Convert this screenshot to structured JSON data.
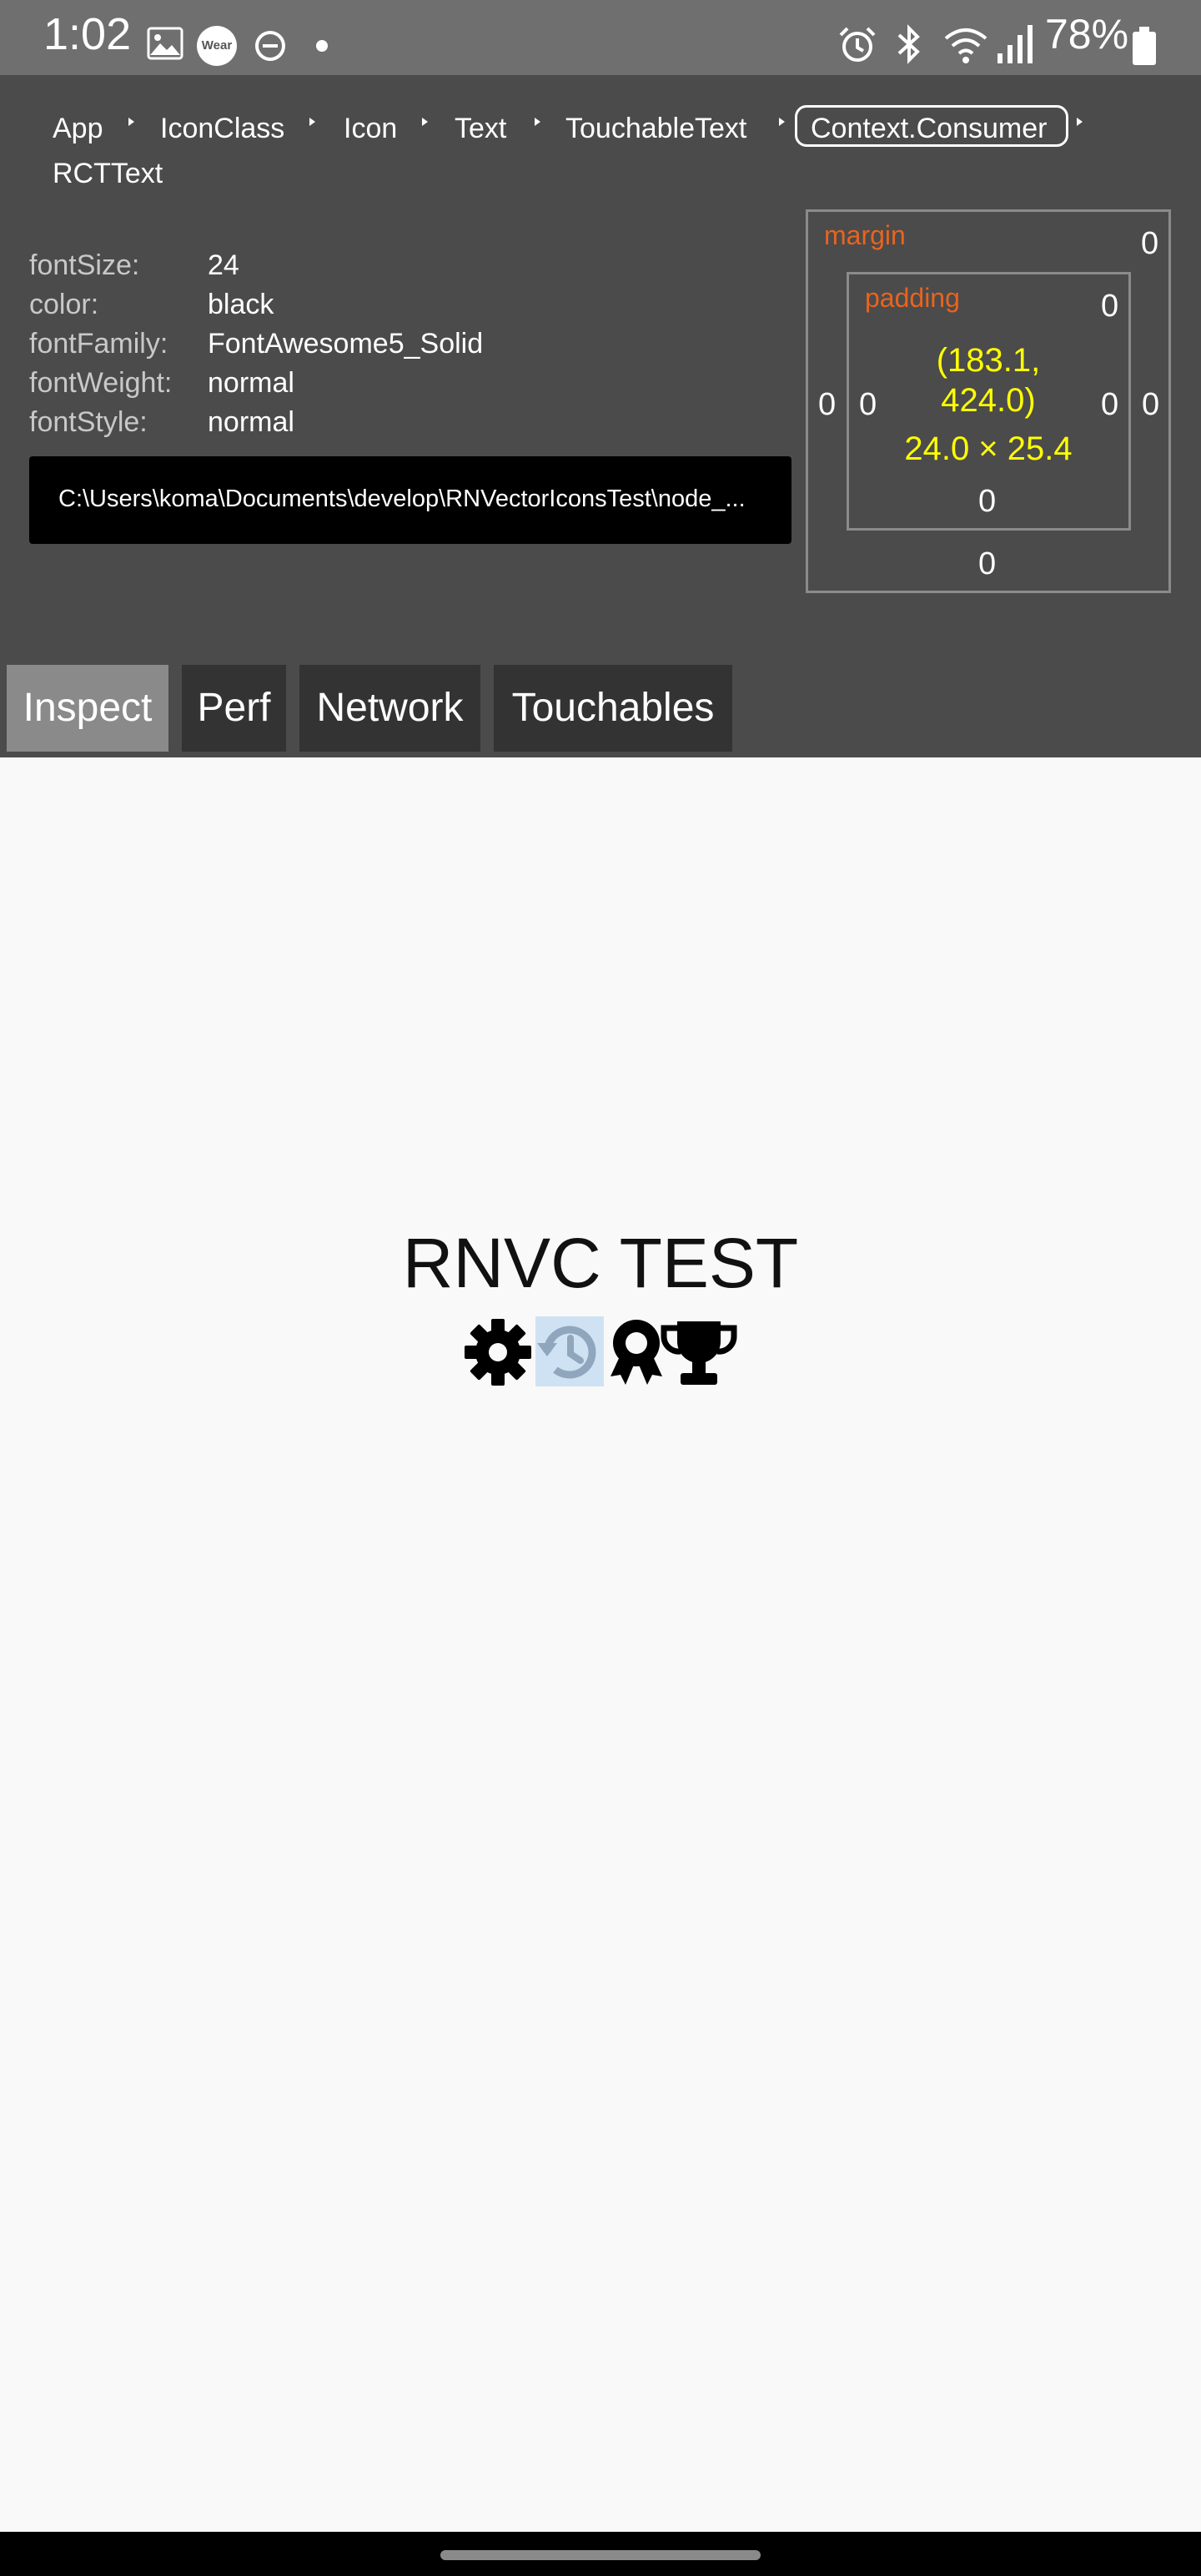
{
  "status_bar": {
    "time": "1:02",
    "battery": "78%",
    "icons": [
      "gallery-icon",
      "wear-icon",
      "do-not-disturb-icon",
      "dot-icon",
      "alarm-icon",
      "bluetooth-icon",
      "wifi-icon",
      "signal-icon",
      "battery-icon"
    ],
    "wear_label": "Wear"
  },
  "breadcrumb": {
    "items": [
      "App",
      "IconClass",
      "Icon",
      "Text",
      "TouchableText",
      "Context.Consumer",
      "RCTText"
    ],
    "selected": "Context.Consumer"
  },
  "style_props": [
    {
      "key": "fontSize:",
      "value": "24"
    },
    {
      "key": "color:",
      "value": "black"
    },
    {
      "key": "fontFamily:",
      "value": "FontAwesome5_Solid"
    },
    {
      "key": "fontWeight:",
      "value": "normal"
    },
    {
      "key": "fontStyle:",
      "value": "normal"
    }
  ],
  "source_path": "C:\\Users\\koma\\Documents\\develop\\RNVectorIconsTest\\node_...",
  "box_model": {
    "margin_label": "margin",
    "padding_label": "padding",
    "margin": {
      "top": "0",
      "right": "0",
      "bottom": "0",
      "left": "0"
    },
    "padding": {
      "top": "0",
      "right": "0",
      "bottom": "0",
      "left": "0"
    },
    "position_line1": "(183.1,",
    "position_line2": "424.0)",
    "size": "24.0 × 25.4"
  },
  "tabs": [
    {
      "label": "Inspect",
      "active": true
    },
    {
      "label": "Perf",
      "active": false
    },
    {
      "label": "Network",
      "active": false
    },
    {
      "label": "Touchables",
      "active": false
    }
  ],
  "app": {
    "title": "RNVC TEST",
    "icons": [
      "gear-icon",
      "history-icon",
      "award-icon",
      "trophy-icon"
    ],
    "highlighted_icon": "history-icon",
    "highlight_color": "#cfe2f3"
  },
  "colors": {
    "status_bar": "#6f6f6f",
    "inspector_bg": "#4b4b4b",
    "accent_orange": "#e8641e",
    "accent_yellow": "#ffff00",
    "tab_active": "#8a8a8a",
    "tab_inactive": "#333333"
  }
}
